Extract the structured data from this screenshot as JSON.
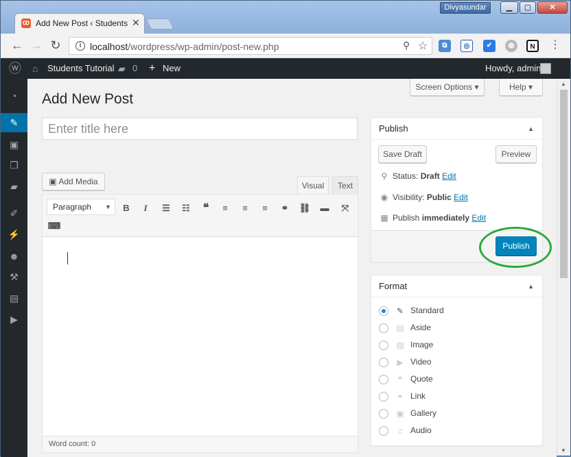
{
  "browser": {
    "user_badge": "Divyasundar",
    "tab_title": "Add New Post ‹ Students",
    "url_host": "localhost",
    "url_path": "/wordpress/wp-admin/post-new.php"
  },
  "adminbar": {
    "site_name": "Students Tutorial",
    "comments_count": "0",
    "new_label": "New",
    "greeting": "Howdy, admin"
  },
  "page": {
    "title": "Add New Post",
    "screen_options": "Screen Options",
    "help": "Help",
    "title_placeholder": "Enter title here"
  },
  "editor": {
    "add_media": "Add Media",
    "tab_visual": "Visual",
    "tab_text": "Text",
    "format_select": "Paragraph",
    "word_count": "Word count: 0"
  },
  "publish": {
    "heading": "Publish",
    "save_draft": "Save Draft",
    "preview": "Preview",
    "status_label": "Status:",
    "status_value": "Draft",
    "visibility_label": "Visibility:",
    "visibility_value": "Public",
    "schedule_label": "Publish",
    "schedule_value": "immediately",
    "edit": "Edit",
    "publish_button": "Publish"
  },
  "format": {
    "heading": "Format",
    "options": [
      "Standard",
      "Aside",
      "Image",
      "Video",
      "Quote",
      "Link",
      "Gallery",
      "Audio"
    ],
    "selected": "Standard"
  },
  "colors": {
    "admin_bar": "#23282d",
    "accent": "#0073aa",
    "publish_button": "#0085ba",
    "highlight_ring": "#2aa83a"
  }
}
